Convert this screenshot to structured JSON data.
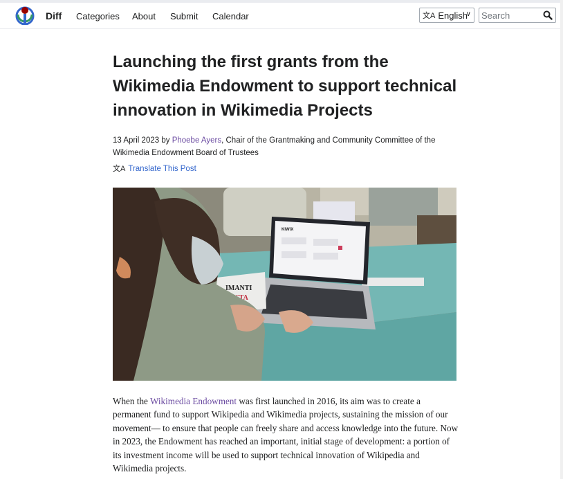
{
  "header": {
    "brand": "Diff",
    "nav": [
      "Categories",
      "About",
      "Submit",
      "Calendar"
    ],
    "language": "English",
    "search_placeholder": "Search"
  },
  "article": {
    "title": "Launching the first grants from the Wikimedia Endowment to support technical innovation in Wikimedia Projects",
    "date": "13 April 2023",
    "by": "by",
    "author": "Phoebe Ayers",
    "author_role": ", Chair of the Grantmaking and Community Committee of the Wikimedia Endowment Board of Trustees",
    "translate_label": "Translate This Post",
    "image_screen_text": "KIWIX",
    "body_before": "When the ",
    "body_link": "Wikimedia Endowment",
    "body_after": " was first launched in 2016, its aim was to create a permanent fund to support Wikipedia and Wikimedia projects, sustaining the mission of our movement— to ensure that people can freely share and access knowledge into the future. Now in 2023, the Endowment has reached an important, initial stage of development: a portion of its investment income will be used to support technical innovation of Wikipedia and Wikimedia projects."
  },
  "colors": {
    "link": "#6b4ba1",
    "translate_link": "#3366cc",
    "text": "#202122"
  }
}
